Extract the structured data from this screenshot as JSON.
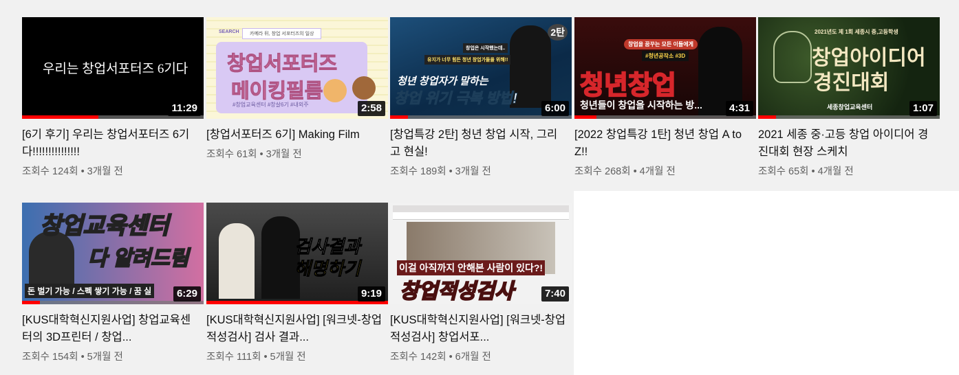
{
  "videos": [
    {
      "title": "[6기 후기] 우리는 창업서포터즈 6기다!!!!!!!!!!!!!!!",
      "views": "조회수 124회",
      "age": "3개월 전",
      "duration": "11:29",
      "watched_fraction": 0.42,
      "thumb_text": [
        "우리는 창업서포터즈 6기다"
      ]
    },
    {
      "title": "[창업서포터즈 6기] Making Film",
      "views": "조회수 61회",
      "age": "3개월 전",
      "duration": "2:58",
      "watched_fraction": 0.0,
      "thumb_text": [
        "SEARCH",
        "카메라 뒤, 창업 서포터즈의 일상",
        "창업서포터즈",
        "메이킹필름",
        "#창업교육센터 #창살6기 #내외주"
      ]
    },
    {
      "title": "[창업특강 2탄] 청년 창업 시작, 그리고 현실!",
      "views": "조회수 189회",
      "age": "3개월 전",
      "duration": "6:00",
      "watched_fraction": 0.1,
      "thumb_text": [
        "2탄",
        "창업은 시작했는데..",
        "유지가 너무 힘든 청년 창업가들을 위해!!",
        "청년 창업자가 말하는",
        "창업 위기 극복 방법!"
      ]
    },
    {
      "title": "[2022 창업특강 1탄] 청년 창업 A to Z!!",
      "views": "조회수 268회",
      "age": "4개월 전",
      "duration": "4:31",
      "watched_fraction": 0.12,
      "thumb_text": [
        "창업을 꿈꾸는 모든 이들에게",
        "#청년공작소 #3D",
        "청년창업",
        "청년들이 창업을 시작하는 방..."
      ]
    },
    {
      "title": "2021 세종 중·고등 창업 아이디어 경진대회 현장 스케치",
      "views": "조회수 65회",
      "age": "4개월 전",
      "duration": "1:07",
      "watched_fraction": 0.1,
      "thumb_text": [
        "2021년도 제 1회 세종시 중,고등학생",
        "창업아이디어",
        "경진대회",
        "세종창업교육센터"
      ]
    },
    {
      "title": "[KUS대학혁신지원사업] 창업교육센터의 3D프린터 / 창업...",
      "views": "조회수 154회",
      "age": "5개월 전",
      "duration": "6:29",
      "watched_fraction": 0.1,
      "thumb_text": [
        "창업교육센터",
        "다 알려드림",
        "돈 벌기 가능 / 스펙 쌓기 가능 / 꿈 실"
      ]
    },
    {
      "title": "[KUS대학혁신지원사업] [워크넷-창업적성검사] 검사 결과...",
      "views": "조회수 111회",
      "age": "5개월 전",
      "duration": "9:19",
      "watched_fraction": 1.0,
      "thumb_text": [
        "검사결과",
        "해명하기"
      ]
    },
    {
      "title": "[KUS대학혁신지원사업] [워크넷-창업적성검사] 창업서포...",
      "views": "조회수 142회",
      "age": "6개월 전",
      "duration": "7:40",
      "watched_fraction": 0.0,
      "thumb_text": [
        "이걸 아직까지 안해본 사람이 있다?!",
        "창업적성검사"
      ]
    }
  ],
  "separator": "•"
}
